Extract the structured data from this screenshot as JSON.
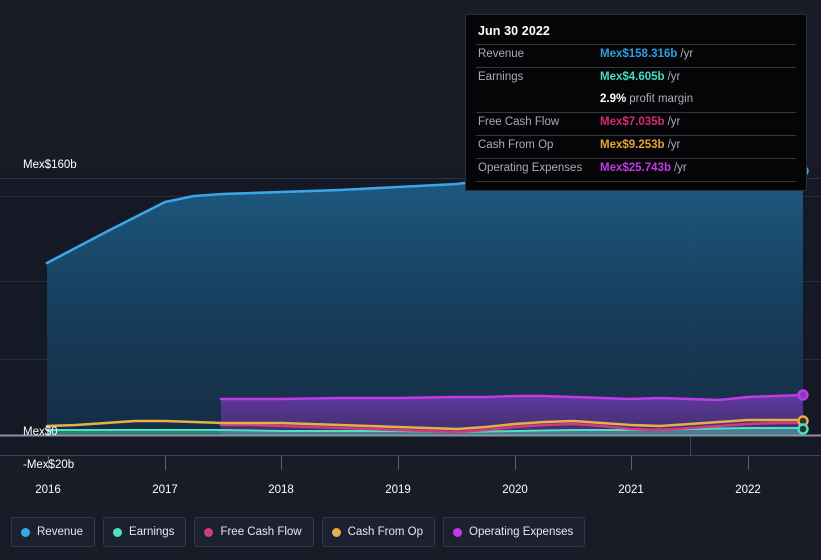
{
  "tooltip": {
    "date": "Jun 30 2022",
    "rows": [
      {
        "label": "Revenue",
        "value": "Mex$158.316b",
        "unit": "/yr",
        "color": "#2f9ee0"
      },
      {
        "label": "Earnings",
        "value": "Mex$4.605b",
        "unit": "/yr",
        "color": "#43ddc2"
      },
      {
        "label": "",
        "value": "2.9%",
        "unit": "profit margin",
        "color": "#ffffff"
      },
      {
        "label": "Free Cash Flow",
        "value": "Mex$7.035b",
        "unit": "/yr",
        "color": "#d62d6e"
      },
      {
        "label": "Cash From Op",
        "value": "Mex$9.253b",
        "unit": "/yr",
        "color": "#e8a33a"
      },
      {
        "label": "Operating Expenses",
        "value": "Mex$25.743b",
        "unit": "/yr",
        "color": "#c13ae8"
      }
    ]
  },
  "axis": {
    "y_top_label": "Mex$160b",
    "y_zero_label": "Mex$0",
    "y_bottom_label": "-Mex$20b",
    "x_labels": [
      "2016",
      "2017",
      "2018",
      "2019",
      "2020",
      "2021",
      "2022"
    ]
  },
  "legend": {
    "items": [
      {
        "label": "Revenue",
        "color": "#3aa7e8"
      },
      {
        "label": "Earnings",
        "color": "#4fe0c0"
      },
      {
        "label": "Free Cash Flow",
        "color": "#d13a7e"
      },
      {
        "label": "Cash From Op",
        "color": "#e8ae4a"
      },
      {
        "label": "Operating Expenses",
        "color": "#c13ae8"
      }
    ]
  },
  "chart_data": {
    "type": "area",
    "title": "",
    "xlabel": "",
    "ylabel": "",
    "currency": "Mex$",
    "unit": "billions per year",
    "ylim": [
      -20,
      160
    ],
    "yticks": [
      -20,
      0,
      160
    ],
    "xlim": [
      2015.75,
      2022.5
    ],
    "grid": true,
    "legend_position": "bottom-left",
    "x": [
      2015.75,
      2016.0,
      2016.25,
      2016.5,
      2016.75,
      2017.0,
      2017.25,
      2017.5,
      2017.75,
      2018.0,
      2018.25,
      2018.5,
      2018.75,
      2019.0,
      2019.25,
      2019.5,
      2019.75,
      2020.0,
      2020.25,
      2020.5,
      2020.75,
      2021.0,
      2021.25,
      2021.5,
      2021.75,
      2022.0,
      2022.25,
      2022.5
    ],
    "series": [
      {
        "name": "Revenue",
        "color": "#3aa7e8",
        "values": [
          107,
          113,
          120,
          127,
          134,
          141,
          143,
          144,
          145,
          145,
          146,
          146,
          147,
          147,
          148,
          148,
          149,
          150,
          152,
          153,
          152,
          150,
          149,
          149,
          150,
          152,
          155,
          158.316
        ]
      },
      {
        "name": "Earnings",
        "color": "#4fe0c0",
        "values": [
          3.0,
          3.1,
          3.2,
          3.2,
          3.3,
          3.3,
          3.2,
          3.1,
          3.0,
          2.9,
          2.9,
          2.8,
          2.7,
          2.6,
          2.5,
          2.4,
          2.3,
          2.4,
          2.6,
          2.8,
          3.0,
          3.2,
          3.5,
          3.8,
          4.0,
          4.2,
          4.4,
          4.605
        ]
      },
      {
        "name": "Free Cash Flow",
        "color": "#d13a7e",
        "values": [
          null,
          null,
          null,
          null,
          null,
          null,
          null,
          6.5,
          6.4,
          6.2,
          5.8,
          5.3,
          4.8,
          4.4,
          4.0,
          3.6,
          3.2,
          3.4,
          4.6,
          5.8,
          6.4,
          5.4,
          4.2,
          4.0,
          5.0,
          6.2,
          6.8,
          7.035
        ]
      },
      {
        "name": "Cash From Op",
        "color": "#e8ae4a",
        "values": [
          5.6,
          6.2,
          7.0,
          7.8,
          8.4,
          8.6,
          8.3,
          7.9,
          7.8,
          7.8,
          7.6,
          7.2,
          6.7,
          6.2,
          5.7,
          5.2,
          4.7,
          5.0,
          6.4,
          7.8,
          8.6,
          7.6,
          6.4,
          6.2,
          7.2,
          8.4,
          9.0,
          9.253
        ]
      },
      {
        "name": "Operating Expenses",
        "color": "#c13ae8",
        "values": [
          null,
          null,
          null,
          null,
          null,
          null,
          null,
          22.6,
          22.7,
          22.8,
          22.9,
          22.9,
          23.0,
          23.0,
          23.1,
          23.2,
          23.3,
          23.6,
          23.9,
          24.1,
          23.9,
          23.7,
          24.0,
          24.4,
          24.8,
          25.1,
          25.4,
          25.743
        ]
      }
    ]
  }
}
